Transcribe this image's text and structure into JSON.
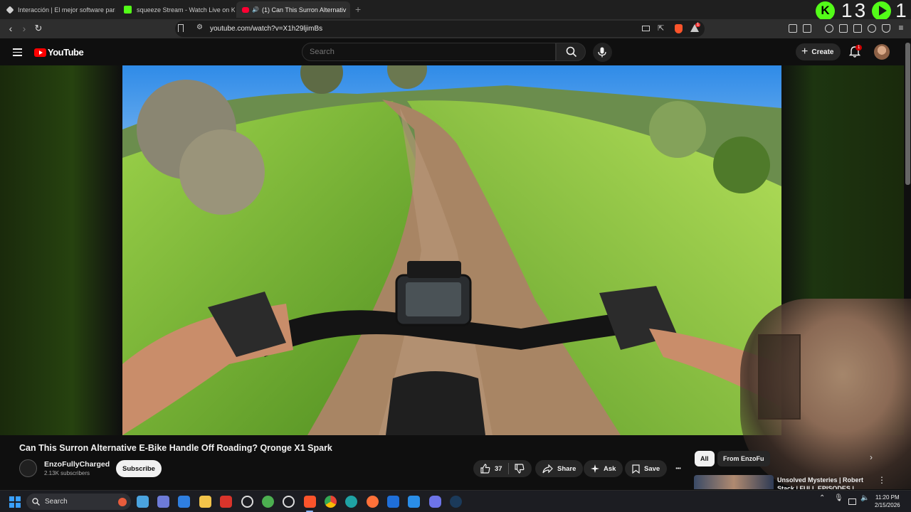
{
  "browser": {
    "tabs": [
      {
        "title": "Interacción | El mejor software para s",
        "favicon_color": "#d0d0d0",
        "active": false
      },
      {
        "title": "squeeze Stream - Watch Live on Kick",
        "favicon_color": "#53fc18",
        "active": false
      },
      {
        "title": "(1) Can This Surron Alternativ",
        "favicon_color": "#ff0033",
        "active": true
      }
    ],
    "close_glyph": "✕",
    "new_tab_glyph": "+",
    "url": "youtube.com/watch?v=X1h29ljimBs",
    "extension_badge": "1",
    "kick_overlay": {
      "logo_letter": "K",
      "count": "13",
      "suffix": "1"
    }
  },
  "youtube": {
    "logo_text": "YouTube",
    "search_placeholder": "Search",
    "create_label": "Create",
    "notification_count": "1"
  },
  "video": {
    "title": "Can This Surron Alternative E-Bike Handle Off Roading? Qronge X1 Spark",
    "channel_name": "EnzoFullyCharged",
    "subscribers": "2.13K subscribers",
    "subscribe_label": "Subscribe",
    "likes": "37",
    "share_label": "Share",
    "ask_label": "Ask",
    "save_label": "Save",
    "more_glyph": "•••"
  },
  "sidebar": {
    "chips": [
      "All",
      "From EnzoFu"
    ],
    "recommendation_title": "Unsolved Mysteries | Robert Stack | FULL EPISODES |",
    "more_glyph": "⋮"
  },
  "taskbar": {
    "search_label": "Search",
    "time": "11:20 PM",
    "date": "2/15/2026",
    "tray_arrow": "⌃"
  },
  "colors": {
    "accent_red": "#ff0000",
    "kick_green": "#53fc18",
    "dark_bg": "#0f0f0f"
  }
}
